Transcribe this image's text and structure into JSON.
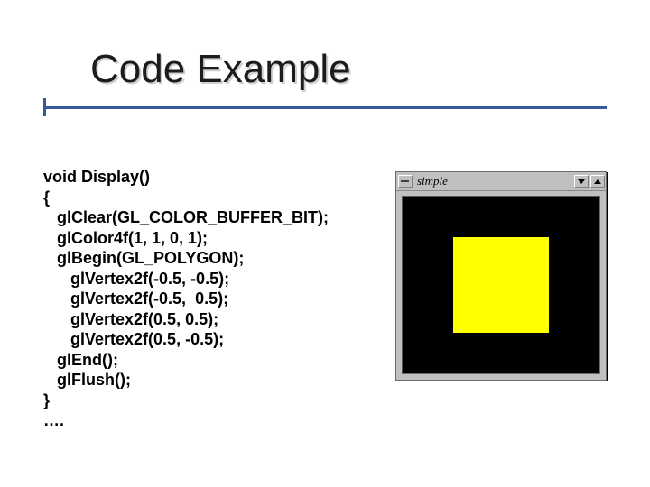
{
  "title": "Code Example",
  "code": {
    "l1": "void Display()",
    "l2": "{",
    "l3": "   glClear(GL_COLOR_BUFFER_BIT);",
    "l4": "   glColor4f(1, 1, 0, 1);",
    "l5": "   glBegin(GL_POLYGON);",
    "l6": "      glVertex2f(-0.5, -0.5);",
    "l7": "      glVertex2f(-0.5,  0.5);",
    "l8": "      glVertex2f(0.5, 0.5);",
    "l9": "      glVertex2f(0.5, -0.5);",
    "l10": "   glEnd();",
    "l11": "   glFlush();",
    "l12": "}",
    "l13": "…."
  },
  "window": {
    "title": "simple"
  },
  "colors": {
    "clear": "#000000",
    "polygon": "#ffff00"
  }
}
